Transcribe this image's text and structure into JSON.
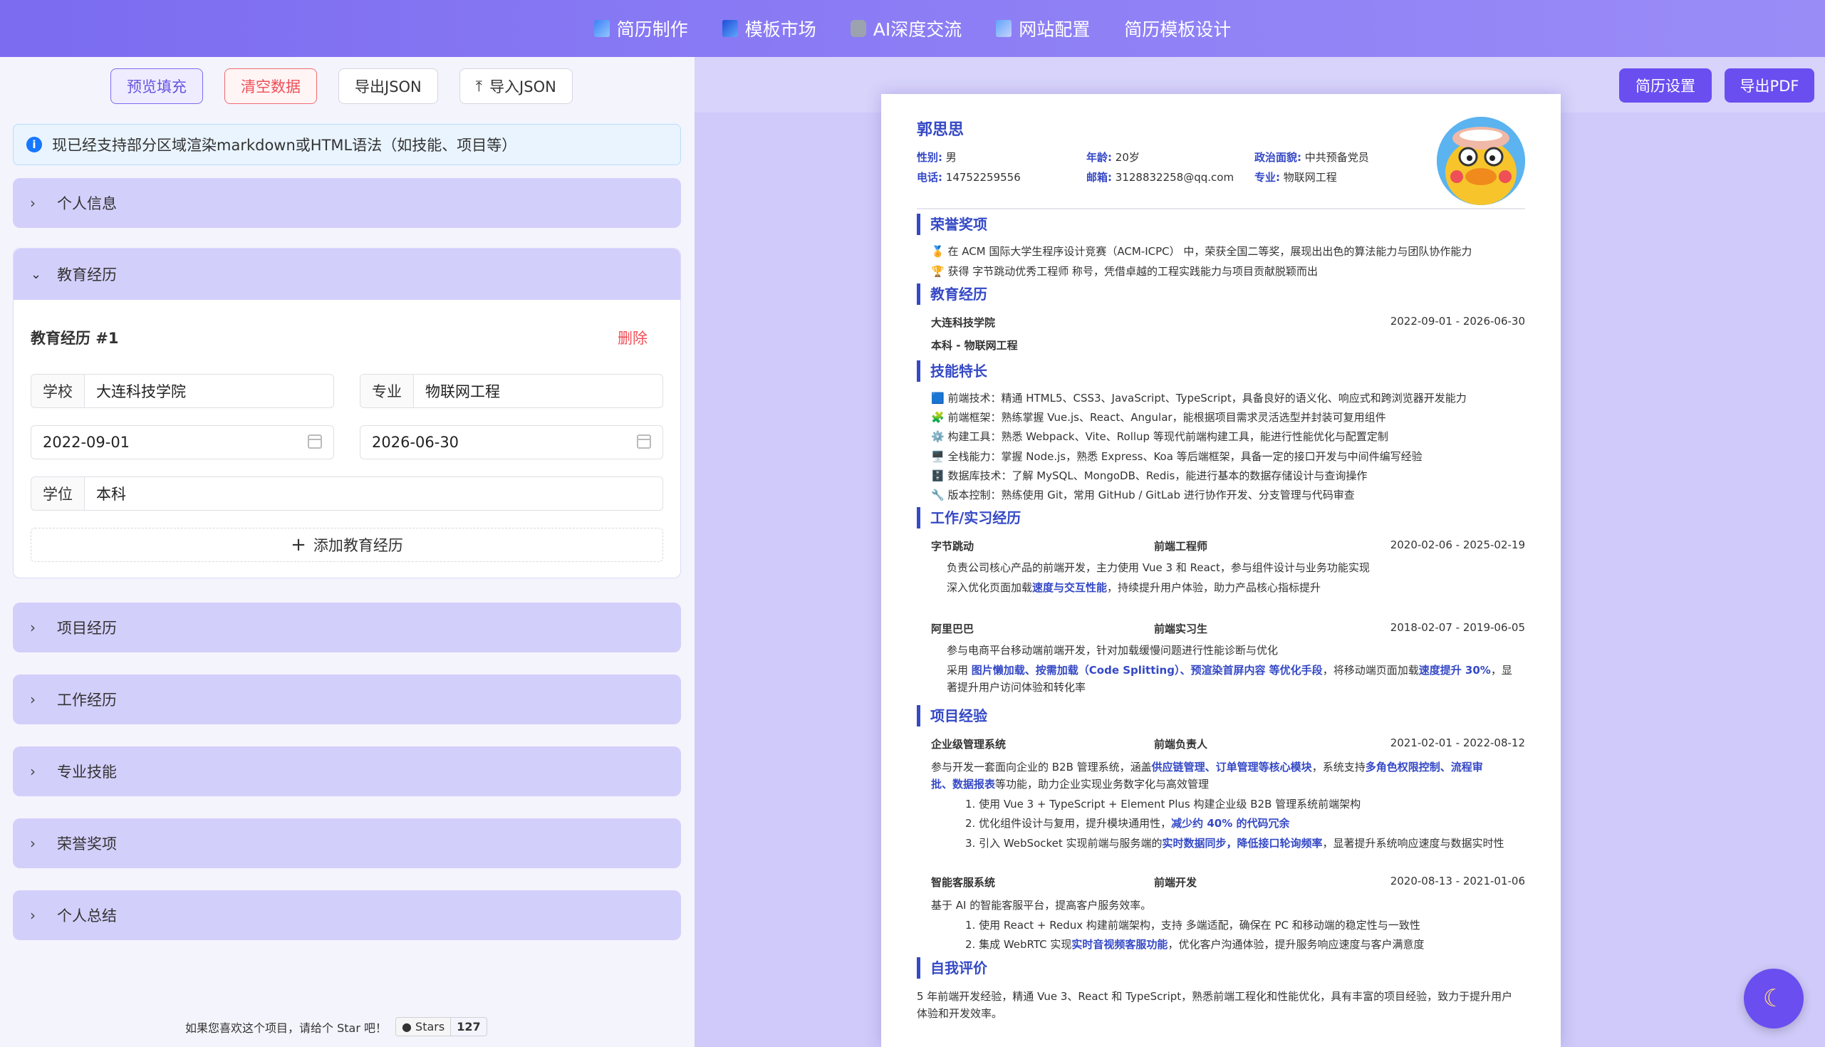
{
  "nav": {
    "items": [
      {
        "label": "简历制作",
        "icon": "doc-icon",
        "color": "#3b82f6"
      },
      {
        "label": "模板市场",
        "icon": "layout-icon",
        "color": "#2563eb"
      },
      {
        "label": "AI深度交流",
        "icon": "robot-icon",
        "color": "#9ca3af"
      },
      {
        "label": "网站配置",
        "icon": "config-icon",
        "color": "#60a5fa"
      },
      {
        "label": "简历模板设计",
        "icon": "",
        "color": ""
      }
    ]
  },
  "toolbar": {
    "preview_fill": "预览填充",
    "clear_data": "清空数据",
    "export_json": "导出JSON",
    "import_json": "导入JSON"
  },
  "notice": "现已经支持部分区域渲染markdown或HTML语法（如技能、项目等）",
  "sections": {
    "personal": "个人信息",
    "education": "教育经历",
    "project": "项目经历",
    "work": "工作经历",
    "skills": "专业技能",
    "honors": "荣誉奖项",
    "summary": "个人总结"
  },
  "edu_form": {
    "title": "教育经历 #1",
    "delete": "删除",
    "school_label": "学校",
    "school": "大连科技学院",
    "major_label": "专业",
    "major": "物联网工程",
    "start": "2022-09-01",
    "end": "2026-06-30",
    "degree_label": "学位",
    "degree": "本科",
    "add": "添加教育经历"
  },
  "footer": {
    "text": "如果您喜欢这个项目，请给个 Star 吧！",
    "stars_label": "Stars",
    "stars": "127"
  },
  "right": {
    "settings": "简历设置",
    "export_pdf": "导出PDF"
  },
  "resume": {
    "name": "郭思思",
    "gender_k": "性别:",
    "gender": "男",
    "age_k": "年龄:",
    "age": "20岁",
    "politics_k": "政治面貌:",
    "politics": "中共预备党员",
    "phone_k": "电话:",
    "phone": "14752259556",
    "email_k": "邮箱:",
    "email": "3128832258@qq.com",
    "major_k": "专业:",
    "major": "物联网工程",
    "honors_title": "荣誉奖项",
    "honors": [
      "🏅 在 ACM 国际大学生程序设计竞赛（ACM-ICPC） 中，荣获全国二等奖，展现出出色的算法能力与团队协作能力",
      "🏆 获得 字节跳动优秀工程师 称号，凭借卓越的工程实践能力与项目贡献脱颖而出"
    ],
    "edu_title": "教育经历",
    "edu_school": "大连科技学院",
    "edu_date": "2022-09-01 - 2026-06-30",
    "edu_degree": "本科 - 物联网工程",
    "skills_title": "技能特长",
    "skills": [
      "🟦 前端技术：精通 HTML5、CSS3、JavaScript、TypeScript，具备良好的语义化、响应式和跨浏览器开发能力",
      "🧩 前端框架：熟练掌握 Vue.js、React、Angular，能根据项目需求灵活选型并封装可复用组件",
      "⚙️ 构建工具：熟悉 Webpack、Vite、Rollup 等现代前端构建工具，能进行性能优化与配置定制",
      "🖥️ 全栈能力：掌握 Node.js，熟悉 Express、Koa 等后端框架，具备一定的接口开发与中间件编写经验",
      "🗄️ 数据库技术：了解 MySQL、MongoDB、Redis，能进行基本的数据存储设计与查询操作",
      "🔧 版本控制：熟练使用 Git，常用 GitHub / GitLab 进行协作开发、分支管理与代码审查"
    ],
    "work_title": "工作/实习经历",
    "work1_company": "字节跳动",
    "work1_role": "前端工程师",
    "work1_date": "2020-02-06 - 2025-02-19",
    "work1_l1": "负责公司核心产品的前端开发，主力使用 Vue 3 和 React，参与组件设计与业务功能实现",
    "work1_l2a": "深入优化页面加载",
    "work1_l2b": "速度与交互性能",
    "work1_l2c": "，持续提升用户体验，助力产品核心指标提升",
    "work2_company": "阿里巴巴",
    "work2_role": "前端实习生",
    "work2_date": "2018-02-07 - 2019-06-05",
    "work2_l1": "参与电商平台移动端前端开发，针对加载缓慢问题进行性能诊断与优化",
    "work2_l2a": "采用 ",
    "work2_l2b": "图片懒加载、按需加载（Code Splitting）、预渲染首屏内容 等优化手段",
    "work2_l2c": "，将移动端页面加载",
    "work2_l2d": "速度提升 30%",
    "work2_l2e": "，显",
    "work2_l3": "著提升用户访问体验和转化率",
    "proj_title": "项目经验",
    "proj1_name": "企业级管理系统",
    "proj1_role": "前端负责人",
    "proj1_date": "2021-02-01 - 2022-08-12",
    "proj1_l1a": "参与开发一套面向企业的 B2B 管理系统，涵盖",
    "proj1_l1b": "供应链管理、订单管理等核心模块",
    "proj1_l1c": "，系统支持",
    "proj1_l1d": "多角色权限控制、流程审",
    "proj1_l2a": "批、数据报表",
    "proj1_l2b": "等功能，助力企业实现业务数字化与高效管理",
    "proj1_i1": "1. 使用 Vue 3 + TypeScript + Element Plus 构建企业级 B2B 管理系统前端架构",
    "proj1_i2a": "2. 优化组件设计与复用，提升模块通用性，",
    "proj1_i2b": "减少约 40% 的代码冗余",
    "proj1_i3a": "3. 引入 WebSocket 实现前端与服务端的",
    "proj1_i3b": "实时数据同步，降低接口轮询频率",
    "proj1_i3c": "，显著提升系统响应速度与数据实时性",
    "proj2_name": "智能客服系统",
    "proj2_role": "前端开发",
    "proj2_date": "2020-08-13 - 2021-01-06",
    "proj2_l1": "基于 AI 的智能客服平台，提高客户服务效率。",
    "proj2_i1": "1. 使用 React + Redux 构建前端架构，支持 多端适配，确保在 PC 和移动端的稳定性与一致性",
    "proj2_i2a": "2. 集成 WebRTC 实现",
    "proj2_i2b": "实时音视频客服功能",
    "proj2_i2c": "，优化客户沟通体验，提升服务响应速度与客户满意度",
    "self_title": "自我评价",
    "self_l1": "5 年前端开发经验，精通 Vue 3、React 和 TypeScript，熟悉前端工程化和性能优化，具有丰富的项目经验，致力于提升用户",
    "self_l2": "体验和开发效率。"
  }
}
